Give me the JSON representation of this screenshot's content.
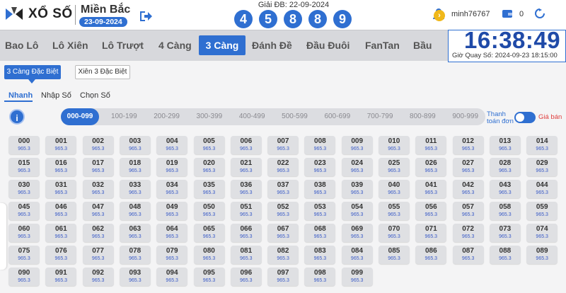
{
  "header": {
    "brand": "XỔ SỐ",
    "region": "Miền Bắc",
    "region_date": "23-09-2024",
    "special_label": "Giải ĐB: 22-09-2024",
    "special_digits": [
      "4",
      "5",
      "8",
      "8",
      "9"
    ],
    "username": "minh76767",
    "balance": "0"
  },
  "nav": {
    "items": [
      "Bao Lô",
      "Lô Xiên",
      "Lô Trượt",
      "4 Càng",
      "3 Càng",
      "Đánh Đề",
      "Đầu Đuôi",
      "FanTan",
      "Bầu"
    ],
    "active": "3 Càng",
    "next_glyph": "›"
  },
  "clock": {
    "time": "16:38:49",
    "draw_time": "Giờ Quay Số: 2024-09-23 18:15:00"
  },
  "subtabs": [
    "3 Càng Đặc Biệt",
    "Xiên 3 Đặc Biệt"
  ],
  "modes": [
    "Nhanh",
    "Nhập Số",
    "Chọn Số"
  ],
  "ranges": [
    "000-099",
    "100-199",
    "200-299",
    "300-399",
    "400-499",
    "500-599",
    "600-699",
    "700-799",
    "800-899",
    "900-999"
  ],
  "options": {
    "pay_label_1": "Thanh",
    "pay_label_2": "toán đơn",
    "price_label": "Giá bán",
    "toggle_on": true
  },
  "grid": {
    "numbers": [
      "000",
      "001",
      "002",
      "003",
      "004",
      "005",
      "006",
      "007",
      "008",
      "009",
      "010",
      "011",
      "012",
      "013",
      "014",
      "015",
      "016",
      "017",
      "018",
      "019",
      "020",
      "021",
      "022",
      "023",
      "024",
      "025",
      "026",
      "027",
      "028",
      "029",
      "030",
      "031",
      "032",
      "033",
      "034",
      "035",
      "036",
      "037",
      "038",
      "039",
      "040",
      "041",
      "042",
      "043",
      "044",
      "045",
      "046",
      "047",
      "048",
      "049",
      "050",
      "051",
      "052",
      "053",
      "054",
      "055",
      "056",
      "057",
      "058",
      "059",
      "060",
      "061",
      "062",
      "063",
      "064",
      "065",
      "066",
      "067",
      "068",
      "069",
      "070",
      "071",
      "072",
      "073",
      "074",
      "075",
      "076",
      "077",
      "078",
      "079",
      "080",
      "081",
      "082",
      "083",
      "084",
      "085",
      "086",
      "087",
      "088",
      "089",
      "090",
      "091",
      "092",
      "093",
      "094",
      "095",
      "096",
      "097",
      "098",
      "099"
    ],
    "odds": "965.3"
  },
  "colors": {
    "accent": "#2f6fd1",
    "clock": "#1f4aa8",
    "price": "#e04040"
  }
}
